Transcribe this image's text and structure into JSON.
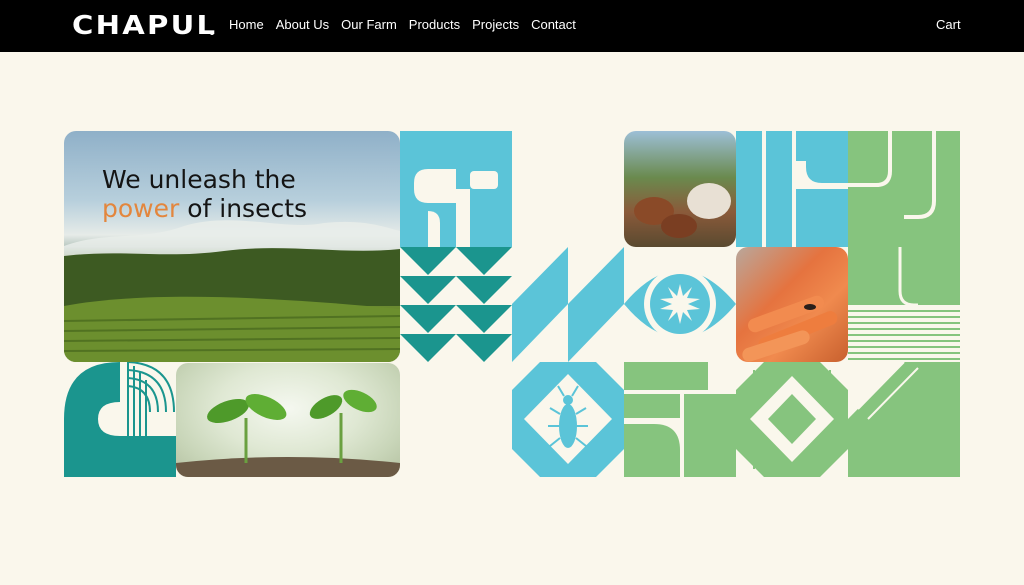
{
  "brand": {
    "name": "CHAPUL"
  },
  "nav": {
    "items": [
      "Home",
      "About Us",
      "Our Farm",
      "Products",
      "Projects",
      "Contact"
    ],
    "cart": "Cart"
  },
  "hero": {
    "line1": "We unleash the",
    "accent": "power",
    "rest": " of insects"
  },
  "colors": {
    "background": "#faf7ec",
    "topbar": "#000000",
    "accent": "#e3863d",
    "blue": "#5bc4d8",
    "teal": "#1b958e",
    "green": "#86c47e"
  },
  "icons": [
    "insect-icon",
    "eye-sunburst-icon"
  ]
}
